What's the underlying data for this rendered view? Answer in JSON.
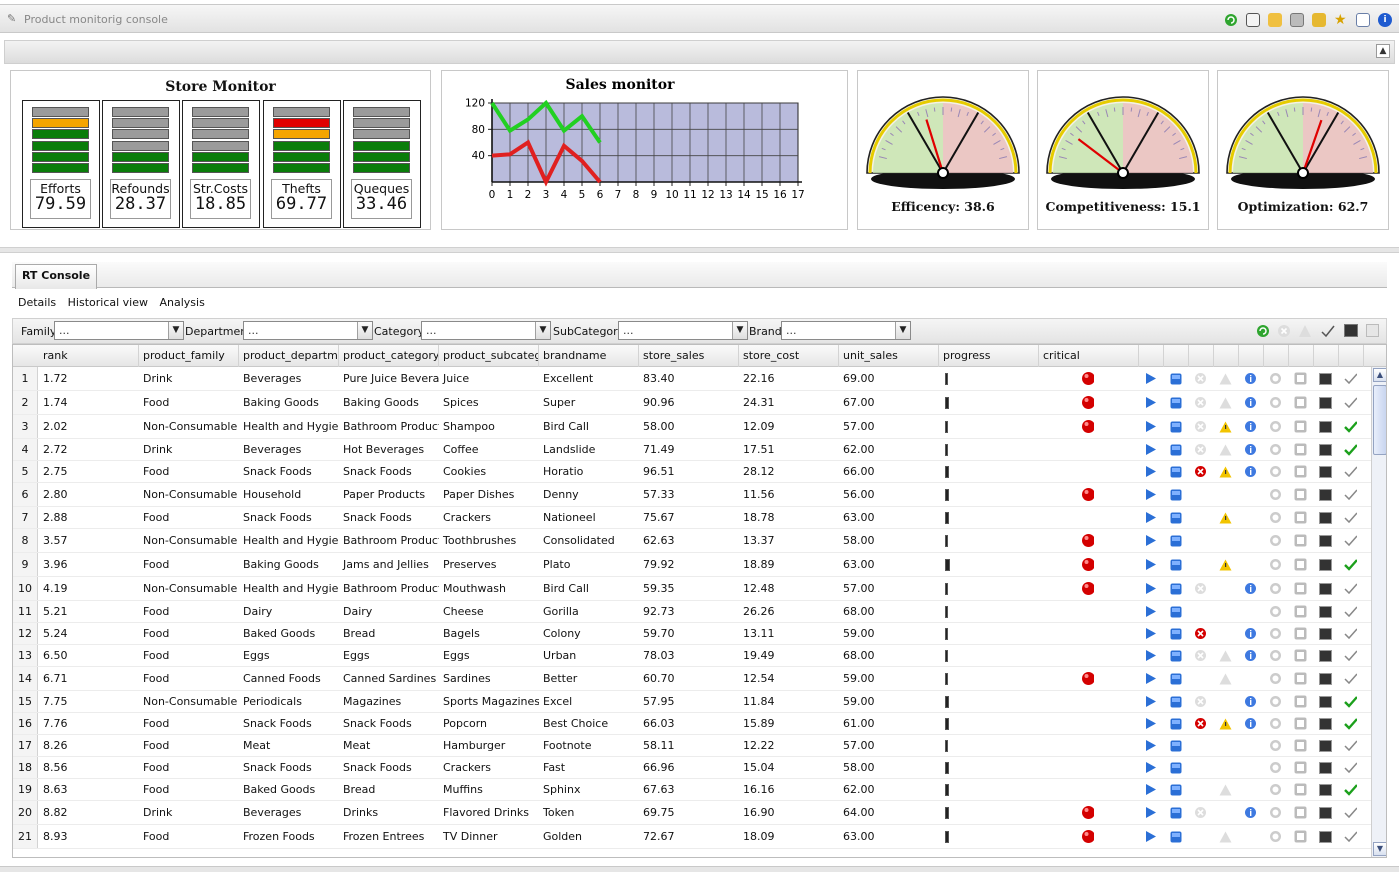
{
  "window": {
    "title": "Product monitorig console"
  },
  "store_monitor": {
    "title": "Store Monitor",
    "meters": [
      {
        "label": "Efforts",
        "value": "79.59",
        "bars": [
          "#9b9b9b",
          "#f5a500",
          "#0a7d0a",
          "#0a7d0a",
          "#0a7d0a",
          "#0a7d0a"
        ]
      },
      {
        "label": "Refounds",
        "value": "28.37",
        "bars": [
          "#9b9b9b",
          "#9b9b9b",
          "#9b9b9b",
          "#9b9b9b",
          "#0a7d0a",
          "#0a7d0a"
        ]
      },
      {
        "label": "Str.Costs",
        "value": "18.85",
        "bars": [
          "#9b9b9b",
          "#9b9b9b",
          "#9b9b9b",
          "#9b9b9b",
          "#0a7d0a",
          "#0a7d0a"
        ]
      },
      {
        "label": "Thefts",
        "value": "69.77",
        "bars": [
          "#9b9b9b",
          "#e00000",
          "#f5a500",
          "#0a7d0a",
          "#0a7d0a",
          "#0a7d0a"
        ]
      },
      {
        "label": "Queques",
        "value": "33.46",
        "bars": [
          "#9b9b9b",
          "#9b9b9b",
          "#9b9b9b",
          "#0a7d0a",
          "#0a7d0a",
          "#0a7d0a"
        ]
      }
    ]
  },
  "chart_data": {
    "type": "line",
    "title": "Sales monitor",
    "x_ticks": [
      "0",
      "1",
      "2",
      "3",
      "4",
      "5",
      "6",
      "7",
      "8",
      "9",
      "10",
      "11",
      "12",
      "13",
      "14",
      "15",
      "16",
      "17"
    ],
    "y_ticks": [
      "40",
      "80",
      "120"
    ],
    "xlim": [
      0,
      17
    ],
    "ylim": [
      0,
      120
    ],
    "grid": true,
    "series": [
      {
        "color": "#22d022",
        "x": [
          0,
          1,
          2,
          3,
          4,
          5,
          6
        ],
        "y": [
          120,
          78,
          95,
          120,
          78,
          100,
          60
        ]
      },
      {
        "color": "#e02020",
        "x": [
          0,
          1,
          2,
          3,
          4,
          5,
          6
        ],
        "y": [
          40,
          42,
          60,
          0,
          55,
          32,
          0
        ]
      }
    ]
  },
  "gauges": [
    {
      "caption": "Efficency: 38.6",
      "value": 38.6
    },
    {
      "caption": "Competitiveness: 15.1",
      "value": 15.1
    },
    {
      "caption": "Optimization: 62.7",
      "value": 62.7
    }
  ],
  "console": {
    "tab": "RT Console",
    "menus": [
      "Details",
      "Historical view",
      "Analysis"
    ],
    "filters": [
      {
        "label": "Family",
        "placeholder": "..."
      },
      {
        "label": "Department",
        "placeholder": "..."
      },
      {
        "label": "Category",
        "placeholder": "..."
      },
      {
        "label": "SubCategory",
        "placeholder": "..."
      },
      {
        "label": "Brand",
        "placeholder": "..."
      }
    ],
    "columns": [
      "rank",
      "product_family",
      "product_departmen",
      "product_category",
      "product_subcatego",
      "brandname",
      "store_sales",
      "store_cost",
      "unit_sales",
      "progress",
      "critical"
    ],
    "rows": [
      [
        "1",
        "1.72",
        "Drink",
        "Beverages",
        "Pure Juice Beverag",
        "Juice",
        "Excellent",
        "83.40",
        "22.16",
        "69.00"
      ],
      [
        "2",
        "1.74",
        "Food",
        "Baking Goods",
        "Baking Goods",
        "Spices",
        "Super",
        "90.96",
        "24.31",
        "67.00"
      ],
      [
        "3",
        "2.02",
        "Non-Consumable",
        "Health and Hygiene",
        "Bathroom Products",
        "Shampoo",
        "Bird Call",
        "58.00",
        "12.09",
        "57.00"
      ],
      [
        "4",
        "2.72",
        "Drink",
        "Beverages",
        "Hot Beverages",
        "Coffee",
        "Landslide",
        "71.49",
        "17.51",
        "62.00"
      ],
      [
        "5",
        "2.75",
        "Food",
        "Snack Foods",
        "Snack Foods",
        "Cookies",
        "Horatio",
        "96.51",
        "28.12",
        "66.00"
      ],
      [
        "6",
        "2.80",
        "Non-Consumable",
        "Household",
        "Paper Products",
        "Paper Dishes",
        "Denny",
        "57.33",
        "11.56",
        "56.00"
      ],
      [
        "7",
        "2.88",
        "Food",
        "Snack Foods",
        "Snack Foods",
        "Crackers",
        "Nationeel",
        "75.67",
        "18.78",
        "63.00"
      ],
      [
        "8",
        "3.57",
        "Non-Consumable",
        "Health and Hygiene",
        "Bathroom Products",
        "Toothbrushes",
        "Consolidated",
        "62.63",
        "13.37",
        "58.00"
      ],
      [
        "9",
        "3.96",
        "Food",
        "Baking Goods",
        "Jams and Jellies",
        "Preserves",
        "Plato",
        "79.92",
        "18.89",
        "63.00"
      ],
      [
        "10",
        "4.19",
        "Non-Consumable",
        "Health and Hygiene",
        "Bathroom Products",
        "Mouthwash",
        "Bird Call",
        "59.35",
        "12.48",
        "57.00"
      ],
      [
        "11",
        "5.21",
        "Food",
        "Dairy",
        "Dairy",
        "Cheese",
        "Gorilla",
        "92.73",
        "26.26",
        "68.00"
      ],
      [
        "12",
        "5.24",
        "Food",
        "Baked Goods",
        "Bread",
        "Bagels",
        "Colony",
        "59.70",
        "13.11",
        "59.00"
      ],
      [
        "13",
        "6.50",
        "Food",
        "Eggs",
        "Eggs",
        "Eggs",
        "Urban",
        "78.03",
        "19.49",
        "68.00"
      ],
      [
        "14",
        "6.71",
        "Food",
        "Canned Foods",
        "Canned Sardines",
        "Sardines",
        "Better",
        "60.70",
        "12.54",
        "59.00"
      ],
      [
        "15",
        "7.75",
        "Non-Consumable",
        "Periodicals",
        "Magazines",
        "Sports Magazines",
        "Excel",
        "57.95",
        "11.84",
        "59.00"
      ],
      [
        "16",
        "7.76",
        "Food",
        "Snack Foods",
        "Snack Foods",
        "Popcorn",
        "Best Choice",
        "66.03",
        "15.89",
        "61.00"
      ],
      [
        "17",
        "8.26",
        "Food",
        "Meat",
        "Meat",
        "Hamburger",
        "Footnote",
        "58.11",
        "12.22",
        "57.00"
      ],
      [
        "18",
        "8.56",
        "Food",
        "Snack Foods",
        "Snack Foods",
        "Crackers",
        "Fast",
        "66.96",
        "15.04",
        "58.00"
      ],
      [
        "19",
        "8.63",
        "Food",
        "Baked Goods",
        "Bread",
        "Muffins",
        "Sphinx",
        "67.63",
        "16.16",
        "62.00"
      ],
      [
        "20",
        "8.82",
        "Drink",
        "Beverages",
        "Drinks",
        "Flavored Drinks",
        "Token",
        "69.75",
        "16.90",
        "64.00"
      ],
      [
        "21",
        "8.93",
        "Food",
        "Frozen Foods",
        "Frozen Entrees",
        "TV Dinner",
        "Golden",
        "72.67",
        "18.09",
        "63.00"
      ]
    ],
    "row_flags": [
      {
        "critical": 1,
        "x": 1,
        "warn": 1,
        "info": 1,
        "check": 0
      },
      {
        "critical": 1,
        "x": 1,
        "warn": 1,
        "info": 1,
        "check": 0
      },
      {
        "critical": 1,
        "x": 1,
        "warn": 2,
        "info": 1,
        "check": 1
      },
      {
        "critical": 0,
        "x": 1,
        "warn": 1,
        "info": 1,
        "check": 1
      },
      {
        "critical": 0,
        "x": 2,
        "warn": 2,
        "info": 1,
        "check": 0
      },
      {
        "critical": 1,
        "x": 0,
        "warn": 0,
        "info": 0,
        "check": 0
      },
      {
        "critical": 0,
        "x": 0,
        "warn": 2,
        "info": 0,
        "check": 0
      },
      {
        "critical": 1,
        "x": 0,
        "warn": 0,
        "info": 0,
        "check": 0
      },
      {
        "critical": 1,
        "x": 0,
        "warn": 2,
        "info": 0,
        "check": 1
      },
      {
        "critical": 1,
        "x": 1,
        "warn": 0,
        "info": 1,
        "check": 0
      },
      {
        "critical": 0,
        "x": 0,
        "warn": 0,
        "info": 0,
        "check": 0
      },
      {
        "critical": 0,
        "x": 2,
        "warn": 0,
        "info": 1,
        "check": 0
      },
      {
        "critical": 0,
        "x": 1,
        "warn": 1,
        "info": 1,
        "check": 0
      },
      {
        "critical": 1,
        "x": 0,
        "warn": 1,
        "info": 0,
        "check": 0
      },
      {
        "critical": 0,
        "x": 1,
        "warn": 0,
        "info": 1,
        "check": 1
      },
      {
        "critical": 0,
        "x": 2,
        "warn": 2,
        "info": 1,
        "check": 1
      },
      {
        "critical": 0,
        "x": 0,
        "warn": 0,
        "info": 0,
        "check": 0
      },
      {
        "critical": 0,
        "x": 0,
        "warn": 0,
        "info": 0,
        "check": 0
      },
      {
        "critical": 0,
        "x": 0,
        "warn": 1,
        "info": 0,
        "check": 1
      },
      {
        "critical": 1,
        "x": 1,
        "warn": 0,
        "info": 1,
        "check": 0
      },
      {
        "critical": 1,
        "x": 0,
        "warn": 1,
        "info": 0,
        "check": 0
      }
    ],
    "progress": [
      0.2,
      0.3,
      0.2,
      0.2,
      0.3,
      0.3,
      0.3,
      0.2,
      0.4,
      0.2,
      0.2,
      0.2,
      0.2,
      0.2,
      0.3,
      0.3,
      0.2,
      0.3,
      0.3,
      0.3,
      0.3
    ]
  }
}
